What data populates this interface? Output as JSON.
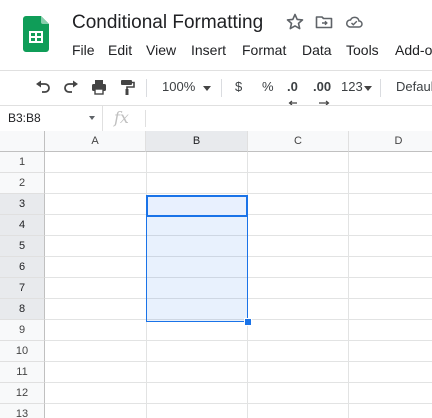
{
  "document": {
    "title": "Conditional Formatting"
  },
  "colors": {
    "brand_green": "#0f9d58",
    "selection_blue": "#1a73e8"
  },
  "menu": [
    "File",
    "Edit",
    "View",
    "Insert",
    "Format",
    "Data",
    "Tools",
    "Add-o"
  ],
  "toolbar": {
    "zoom": "100%",
    "currency": "$",
    "percent": "%",
    "decrease_decimals": ".0",
    "increase_decimals": ".00",
    "number_format": "123",
    "font": "Defaul"
  },
  "formula_bar": {
    "name_box": "B3:B8",
    "fx": "fx"
  },
  "grid": {
    "columns": [
      "A",
      "B",
      "C",
      "D"
    ],
    "rows": [
      "1",
      "2",
      "3",
      "4",
      "5",
      "6",
      "7",
      "8",
      "9",
      "10",
      "11",
      "12",
      "13"
    ],
    "selected_range": "B3:B8",
    "active_cell": "B3"
  },
  "icons": {
    "logo": "sheets-logo-icon",
    "star": "star-icon",
    "move": "move-to-folder-icon",
    "cloud": "cloud-status-icon",
    "undo": "undo-icon",
    "redo": "redo-icon",
    "print": "print-icon",
    "paint_format": "paint-format-icon"
  }
}
